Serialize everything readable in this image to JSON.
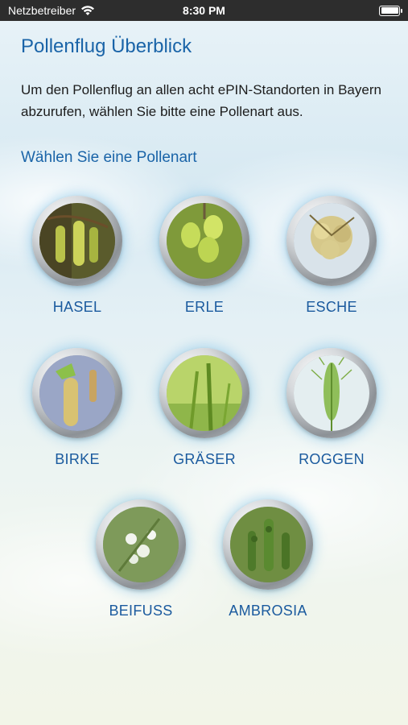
{
  "status_bar": {
    "carrier": "Netzbetreiber",
    "time": "8:30 PM",
    "icons": [
      "wifi-icon",
      "battery-icon"
    ]
  },
  "page": {
    "title": "Pollenflug Überblick",
    "intro": "Um den Pollenflug an allen acht ePIN-Standorten in Bayern abzurufen, wählen Sie bitte eine Pollenart aus.",
    "subtitle": "Wählen Sie eine Pollenart"
  },
  "colors": {
    "heading": "#1a64a8",
    "label": "#1a5a9e",
    "status_bar_bg": "#2d2d2d"
  },
  "pollen_types": [
    {
      "label": "HASEL",
      "icon": "hazel-catkin-image"
    },
    {
      "label": "ERLE",
      "icon": "alder-catkin-image"
    },
    {
      "label": "ESCHE",
      "icon": "ash-flower-image"
    },
    {
      "label": "BIRKE",
      "icon": "birch-catkin-image"
    },
    {
      "label": "GRÄSER",
      "icon": "grass-image"
    },
    {
      "label": "ROGGEN",
      "icon": "rye-image"
    },
    {
      "label": "BEIFUSS",
      "icon": "mugwort-image"
    },
    {
      "label": "AMBROSIA",
      "icon": "ragweed-image"
    }
  ]
}
